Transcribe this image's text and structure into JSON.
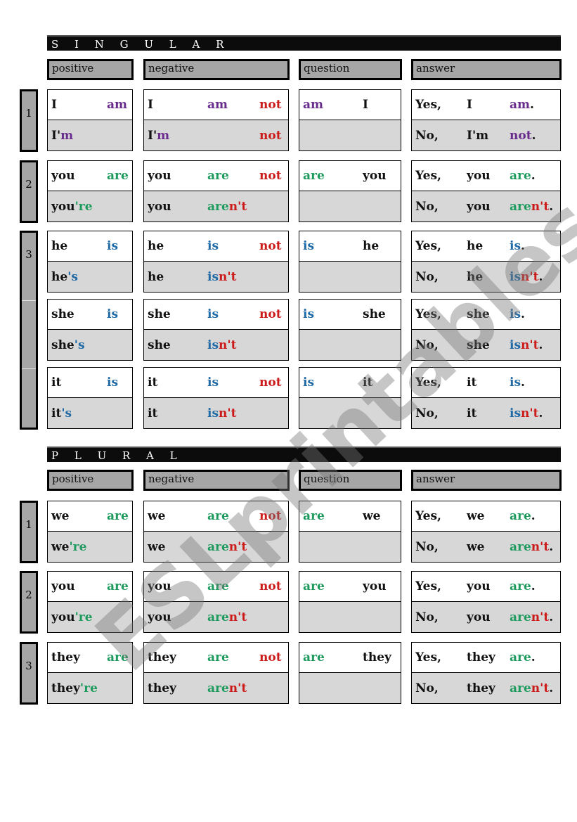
{
  "sections": {
    "singular": {
      "title": "S I N G U L A R"
    },
    "plural": {
      "title": "P L U R A L"
    }
  },
  "headers": {
    "positive": "positive",
    "negative": "negative",
    "question": "question",
    "answer": "answer"
  },
  "numbers": {
    "one": "1",
    "two": "2",
    "three": "3"
  },
  "colors": {
    "am": "#6a2c8c",
    "are": "#1e9a5e",
    "is": "#1f6aa6",
    "not": "#cc1b1b"
  },
  "singular_rows": [
    {
      "person": "1",
      "pos": {
        "subj": "I",
        "verb": "am",
        "contr_subj": "I'",
        "contr_verb": "m"
      },
      "neg": {
        "subj": "I",
        "verb": "am",
        "not": "not",
        "contr_subj": "I'",
        "contr_verb": "m",
        "contr_not": "not"
      },
      "q": {
        "verb": "am",
        "subj": "I"
      },
      "ans": {
        "yes": "Yes,",
        "yes_subj": "I",
        "yes_verb": "am",
        "no": "No,",
        "no_subj": "I'm",
        "no_verb": "",
        "no_neg": "not",
        "dot": "."
      }
    },
    {
      "person": "2",
      "pos": {
        "subj": "you",
        "verb": "are",
        "contr_subj": "you",
        "contr_verb": "'re"
      },
      "neg": {
        "subj": "you",
        "verb": "are",
        "not": "not",
        "contr_subj": "you",
        "contr_verb": "are",
        "contr_not": "n't"
      },
      "q": {
        "verb": "are",
        "subj": "you"
      },
      "ans": {
        "yes": "Yes,",
        "yes_subj": "you",
        "yes_verb": "are",
        "no": "No,",
        "no_subj": "you",
        "no_verb": "are",
        "no_neg": "n't",
        "dot": "."
      }
    },
    {
      "person": "3",
      "pos": {
        "subj": "he",
        "verb": "is",
        "contr_subj": "he",
        "contr_verb": "'s"
      },
      "neg": {
        "subj": "he",
        "verb": "is",
        "not": "not",
        "contr_subj": "he",
        "contr_verb": "is",
        "contr_not": "n't"
      },
      "q": {
        "verb": "is",
        "subj": "he"
      },
      "ans": {
        "yes": "Yes,",
        "yes_subj": "he",
        "yes_verb": "is",
        "no": "No,",
        "no_subj": "he",
        "no_verb": "is",
        "no_neg": "n't",
        "dot": "."
      }
    },
    {
      "person": "3",
      "pos": {
        "subj": "she",
        "verb": "is",
        "contr_subj": "she",
        "contr_verb": "'s"
      },
      "neg": {
        "subj": "she",
        "verb": "is",
        "not": "not",
        "contr_subj": "she",
        "contr_verb": "is",
        "contr_not": "n't"
      },
      "q": {
        "verb": "is",
        "subj": "she"
      },
      "ans": {
        "yes": "Yes,",
        "yes_subj": "she",
        "yes_verb": "is",
        "no": "No,",
        "no_subj": "she",
        "no_verb": "is",
        "no_neg": "n't",
        "dot": "."
      }
    },
    {
      "person": "3",
      "pos": {
        "subj": "it",
        "verb": "is",
        "contr_subj": "it",
        "contr_verb": "'s"
      },
      "neg": {
        "subj": "it",
        "verb": "is",
        "not": "not",
        "contr_subj": "it",
        "contr_verb": "is",
        "contr_not": "n't"
      },
      "q": {
        "verb": "is",
        "subj": "it"
      },
      "ans": {
        "yes": "Yes,",
        "yes_subj": "it",
        "yes_verb": "is",
        "no": "No,",
        "no_subj": "it",
        "no_verb": "is",
        "no_neg": "n't",
        "dot": "."
      }
    }
  ],
  "plural_rows": [
    {
      "person": "1",
      "pos": {
        "subj": "we",
        "verb": "are",
        "contr_subj": "we",
        "contr_verb": "'re"
      },
      "neg": {
        "subj": "we",
        "verb": "are",
        "not": "not",
        "contr_subj": "we",
        "contr_verb": "are",
        "contr_not": "n't"
      },
      "q": {
        "verb": "are",
        "subj": "we"
      },
      "ans": {
        "yes": "Yes,",
        "yes_subj": "we",
        "yes_verb": "are",
        "no": "No,",
        "no_subj": "we",
        "no_verb": "are",
        "no_neg": "n't",
        "dot": "."
      }
    },
    {
      "person": "2",
      "pos": {
        "subj": "you",
        "verb": "are",
        "contr_subj": "you",
        "contr_verb": "'re"
      },
      "neg": {
        "subj": "you",
        "verb": "are",
        "not": "not",
        "contr_subj": "you",
        "contr_verb": "are",
        "contr_not": "n't"
      },
      "q": {
        "verb": "are",
        "subj": "you"
      },
      "ans": {
        "yes": "Yes,",
        "yes_subj": "you",
        "yes_verb": "are",
        "no": "No,",
        "no_subj": "you",
        "no_verb": "are",
        "no_neg": "n't",
        "dot": "."
      }
    },
    {
      "person": "3",
      "pos": {
        "subj": "they",
        "verb": "are",
        "contr_subj": "they",
        "contr_verb": "'re"
      },
      "neg": {
        "subj": "they",
        "verb": "are",
        "not": "not",
        "contr_subj": "they",
        "contr_verb": "are",
        "contr_not": "n't"
      },
      "q": {
        "verb": "are",
        "subj": "they"
      },
      "ans": {
        "yes": "Yes,",
        "yes_subj": "they",
        "yes_verb": "are",
        "no": "No,",
        "no_subj": "they",
        "no_verb": "are",
        "no_neg": "n't",
        "dot": "."
      }
    }
  ],
  "watermark": "ESLprintables.com"
}
